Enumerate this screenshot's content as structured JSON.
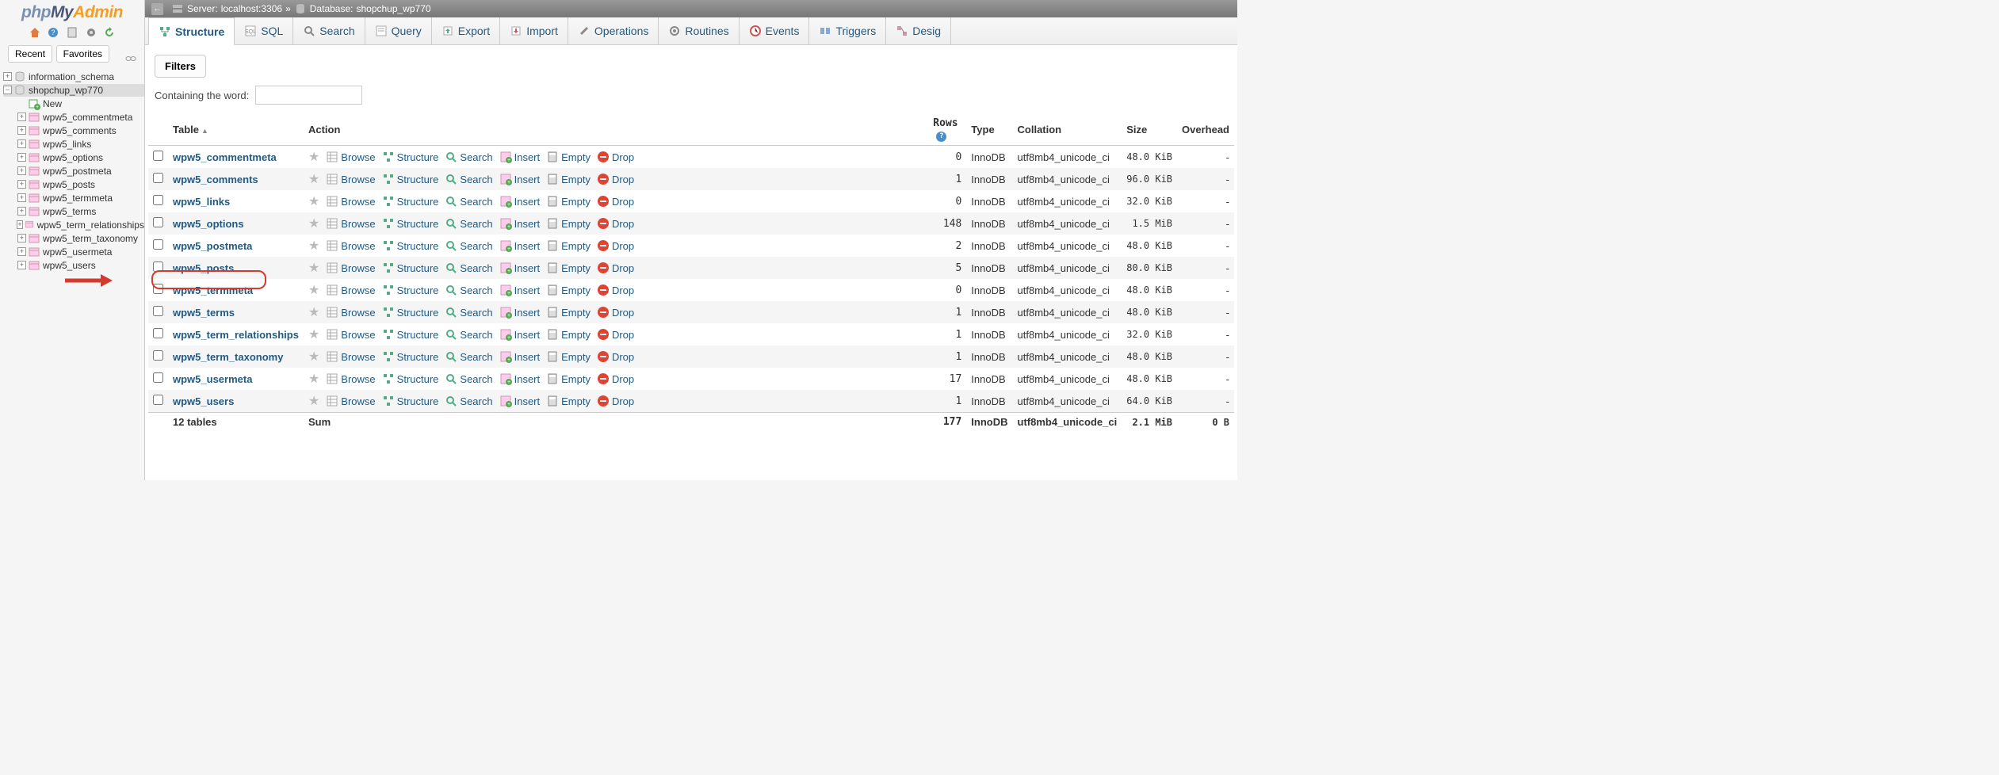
{
  "logo_parts": {
    "p": "php",
    "m": "My",
    "a": "Admin"
  },
  "sidebar": {
    "recent": "Recent",
    "favorites": "Favorites",
    "dbs": [
      {
        "name": "information_schema",
        "expanded": false
      },
      {
        "name": "shopchup_wp770",
        "expanded": true,
        "selected": true,
        "children": [
          {
            "name": "New",
            "new": true
          },
          {
            "name": "wpw5_commentmeta"
          },
          {
            "name": "wpw5_comments"
          },
          {
            "name": "wpw5_links"
          },
          {
            "name": "wpw5_options"
          },
          {
            "name": "wpw5_postmeta"
          },
          {
            "name": "wpw5_posts"
          },
          {
            "name": "wpw5_termmeta"
          },
          {
            "name": "wpw5_terms"
          },
          {
            "name": "wpw5_term_relationships"
          },
          {
            "name": "wpw5_term_taxonomy"
          },
          {
            "name": "wpw5_usermeta"
          },
          {
            "name": "wpw5_users"
          }
        ]
      }
    ]
  },
  "breadcrumb": {
    "server_label": "Server:",
    "server": "localhost:3306",
    "database_label": "Database:",
    "database": "shopchup_wp770",
    "sep": "»"
  },
  "tabs": [
    {
      "id": "structure",
      "label": "Structure",
      "active": true
    },
    {
      "id": "sql",
      "label": "SQL"
    },
    {
      "id": "search",
      "label": "Search"
    },
    {
      "id": "query",
      "label": "Query"
    },
    {
      "id": "export",
      "label": "Export"
    },
    {
      "id": "import",
      "label": "Import"
    },
    {
      "id": "operations",
      "label": "Operations"
    },
    {
      "id": "routines",
      "label": "Routines"
    },
    {
      "id": "events",
      "label": "Events"
    },
    {
      "id": "triggers",
      "label": "Triggers"
    },
    {
      "id": "designer",
      "label": "Desig"
    }
  ],
  "filters": {
    "title": "Filters",
    "containing": "Containing the word:"
  },
  "columns": {
    "table": "Table",
    "action": "Action",
    "rows": "Rows",
    "type": "Type",
    "collation": "Collation",
    "size": "Size",
    "overhead": "Overhead"
  },
  "actions": {
    "browse": "Browse",
    "structure": "Structure",
    "search": "Search",
    "insert": "Insert",
    "empty": "Empty",
    "drop": "Drop"
  },
  "rows": [
    {
      "name": "wpw5_commentmeta",
      "rows": 0,
      "type": "InnoDB",
      "collation": "utf8mb4_unicode_ci",
      "size": "48.0 KiB",
      "overhead": "-"
    },
    {
      "name": "wpw5_comments",
      "rows": 1,
      "type": "InnoDB",
      "collation": "utf8mb4_unicode_ci",
      "size": "96.0 KiB",
      "overhead": "-"
    },
    {
      "name": "wpw5_links",
      "rows": 0,
      "type": "InnoDB",
      "collation": "utf8mb4_unicode_ci",
      "size": "32.0 KiB",
      "overhead": "-"
    },
    {
      "name": "wpw5_options",
      "rows": 148,
      "type": "InnoDB",
      "collation": "utf8mb4_unicode_ci",
      "size": "1.5 MiB",
      "overhead": "-"
    },
    {
      "name": "wpw5_postmeta",
      "rows": 2,
      "type": "InnoDB",
      "collation": "utf8mb4_unicode_ci",
      "size": "48.0 KiB",
      "overhead": "-"
    },
    {
      "name": "wpw5_posts",
      "rows": 5,
      "type": "InnoDB",
      "collation": "utf8mb4_unicode_ci",
      "size": "80.0 KiB",
      "overhead": "-"
    },
    {
      "name": "wpw5_termmeta",
      "rows": 0,
      "type": "InnoDB",
      "collation": "utf8mb4_unicode_ci",
      "size": "48.0 KiB",
      "overhead": "-"
    },
    {
      "name": "wpw5_terms",
      "rows": 1,
      "type": "InnoDB",
      "collation": "utf8mb4_unicode_ci",
      "size": "48.0 KiB",
      "overhead": "-"
    },
    {
      "name": "wpw5_term_relationships",
      "rows": 1,
      "type": "InnoDB",
      "collation": "utf8mb4_unicode_ci",
      "size": "32.0 KiB",
      "overhead": "-"
    },
    {
      "name": "wpw5_term_taxonomy",
      "rows": 1,
      "type": "InnoDB",
      "collation": "utf8mb4_unicode_ci",
      "size": "48.0 KiB",
      "overhead": "-"
    },
    {
      "name": "wpw5_usermeta",
      "rows": 17,
      "type": "InnoDB",
      "collation": "utf8mb4_unicode_ci",
      "size": "48.0 KiB",
      "overhead": "-"
    },
    {
      "name": "wpw5_users",
      "rows": 1,
      "type": "InnoDB",
      "collation": "utf8mb4_unicode_ci",
      "size": "64.0 KiB",
      "overhead": "-",
      "highlighted": true
    }
  ],
  "sum": {
    "label": "12 tables",
    "sum": "Sum",
    "rows": 177,
    "type": "InnoDB",
    "collation": "utf8mb4_unicode_ci",
    "size": "2.1 MiB",
    "overhead": "0 B"
  }
}
